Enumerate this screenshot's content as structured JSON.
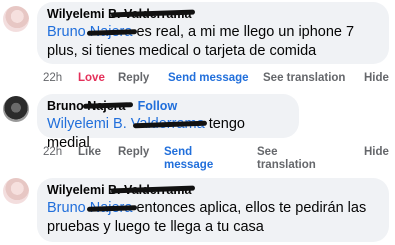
{
  "comments": [
    {
      "author": "Wilyelemi B. Valderrama",
      "mention": "Bruno Najera",
      "text": " es real, a mi me llego un iphone 7 plus, si tienes medical o tarjeta de comida",
      "actions": {
        "time": "22h",
        "reaction": "Love",
        "reply": "Reply",
        "send": "Send message",
        "translate": "See translation",
        "hide": "Hide"
      }
    },
    {
      "author": "Bruno Najera",
      "follow": "Follow",
      "mention": "Wilyelemi B. Valderrama",
      "text": " tengo medial",
      "actions": {
        "time": "22h",
        "reaction": "Like",
        "reply": "Reply",
        "send": "Send message",
        "translate": "See translation",
        "hide": "Hide"
      }
    },
    {
      "author": "Wilyelemi B. Valderrama",
      "mention": "Bruno Najera",
      "text": " entonces aplica, ellos te pedirán las pruebas y luego te llega a tu casa"
    }
  ],
  "colors": {
    "link": "#216fdb",
    "love": "#e4305a",
    "bubble": "#f0f2f5",
    "meta": "#65676b"
  }
}
